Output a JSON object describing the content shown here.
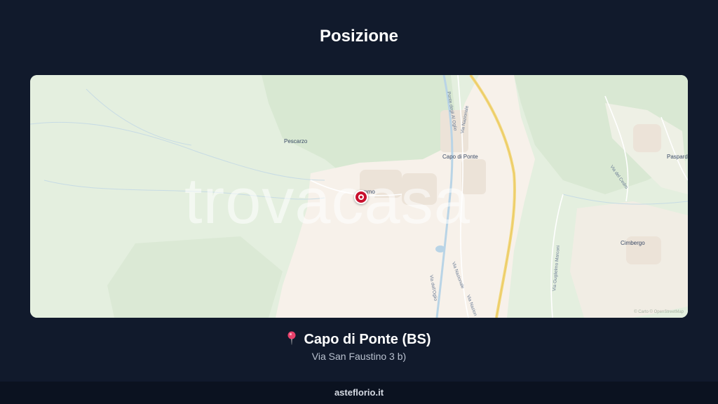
{
  "header": {
    "title": "Posizione"
  },
  "map": {
    "watermark": "trovacasa",
    "attribution": "© Carto © OpenStreetMap",
    "places": {
      "pescarzo": "Pescarzo",
      "capo_di_ponte": "Capo di Ponte",
      "cimbergo": "Cimbergo",
      "paspardo": "Paspardo",
      "partial": "mmo"
    },
    "roads": {
      "via_nazionale_a": "Via Nazionale",
      "via_nazionale_b": "Via Nazionale",
      "via_nazionale_c": "Via Nazion",
      "via_guglielmo_marconi": "Via Guglielmo Marconi",
      "via_dell_oglio": "Via dell'Oglio",
      "via_del_cedro": "Via del Cedro",
      "via_degli_rock": "Ponte degli Al Oglio"
    },
    "colors": {
      "land": "#e4efdf",
      "urban": "#f7f1ea",
      "river": "#b9d4e6",
      "highway": "#f2d77c",
      "marker": "#c8102e"
    }
  },
  "location": {
    "pin_icon": "map-pin-icon",
    "city": "Capo di Ponte (BS)",
    "address": "Via San Faustino 3 b)"
  },
  "footer": {
    "brand": "asteflorio.it"
  }
}
